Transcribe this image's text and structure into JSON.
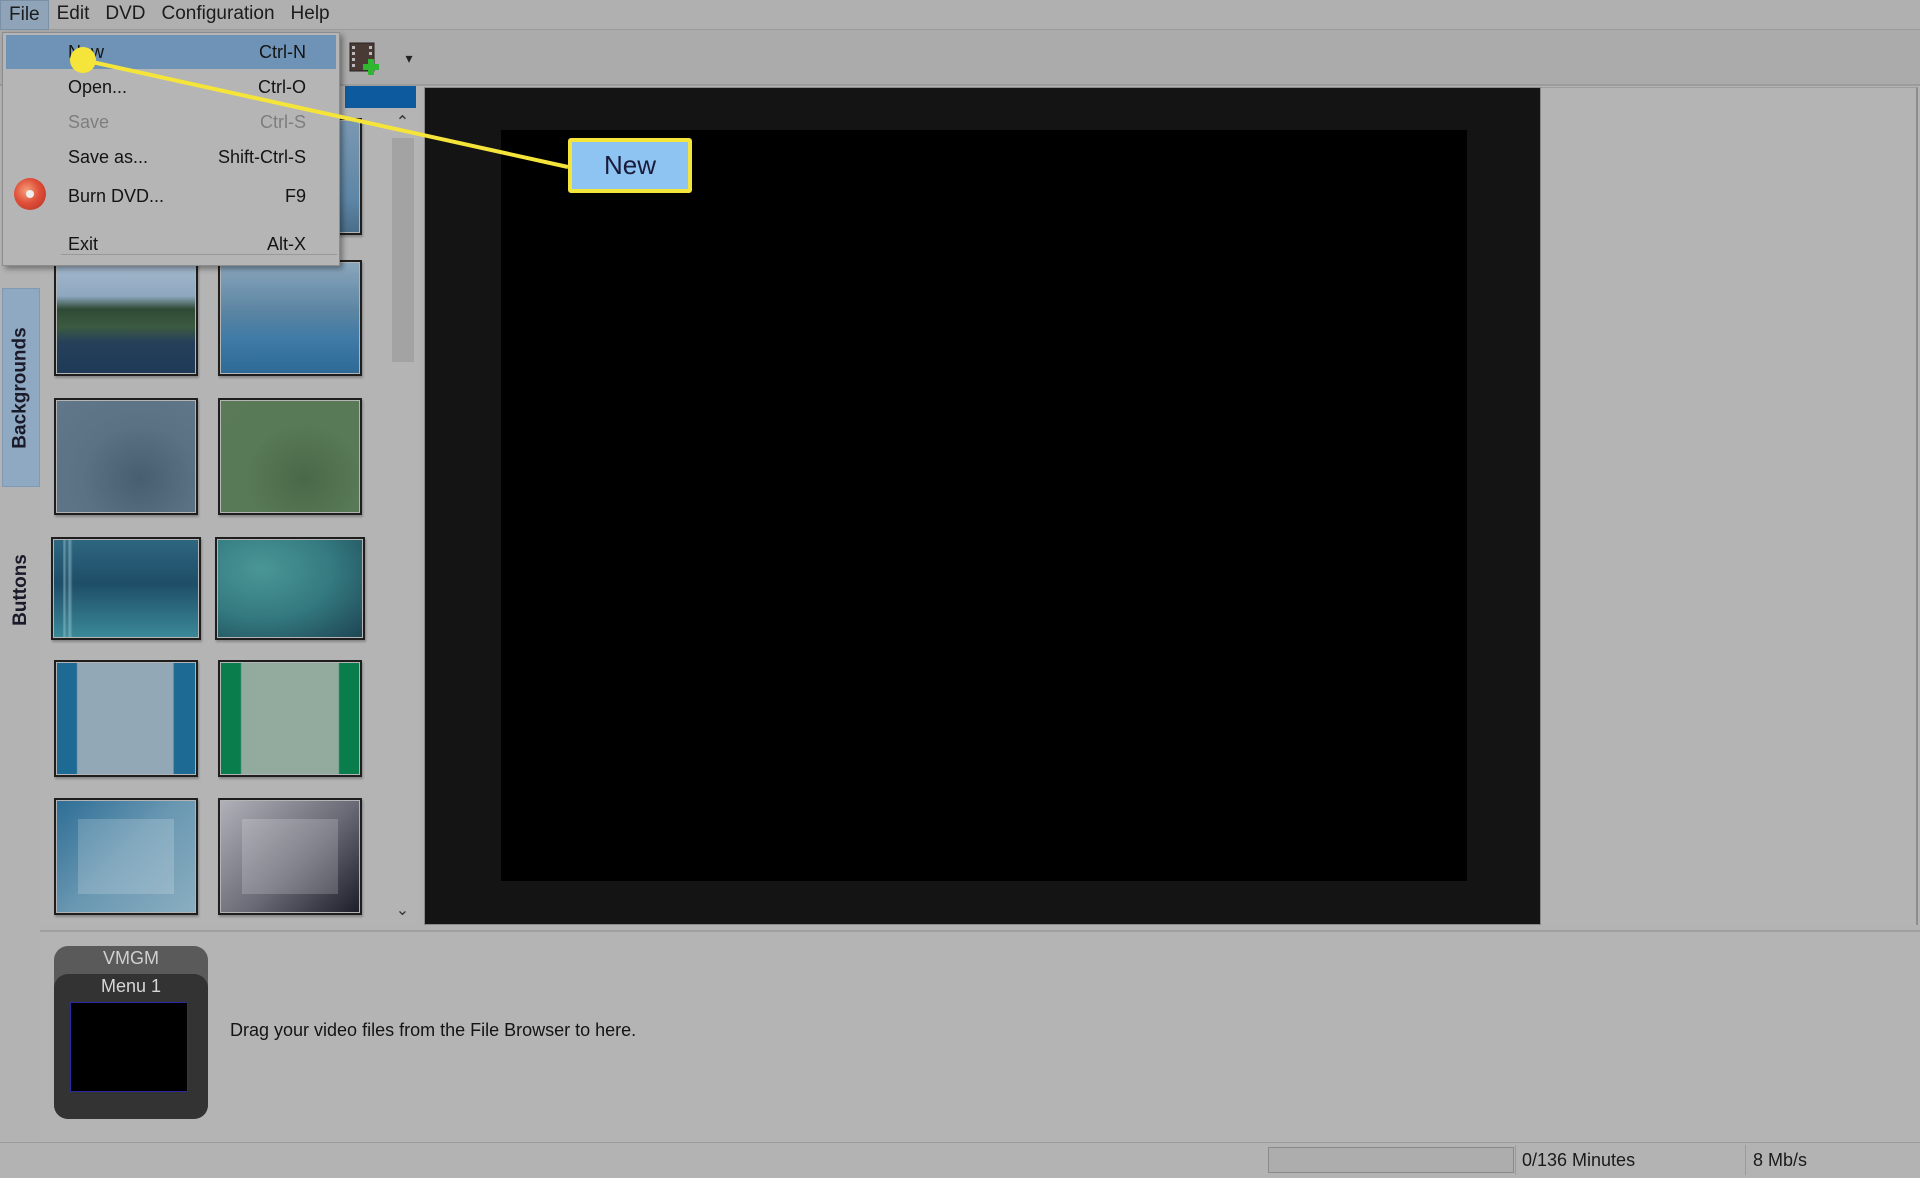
{
  "menubar": {
    "items": [
      {
        "label": "File",
        "active": true
      },
      {
        "label": "Edit"
      },
      {
        "label": "DVD"
      },
      {
        "label": "Configuration"
      },
      {
        "label": "Help"
      }
    ]
  },
  "file_menu": {
    "items": [
      {
        "label": "New",
        "shortcut": "Ctrl-N",
        "highlighted": true,
        "enabled": true
      },
      {
        "label": "Open...",
        "shortcut": "Ctrl-O",
        "enabled": true
      },
      {
        "label": "Save",
        "shortcut": "Ctrl-S",
        "enabled": false
      },
      {
        "label": "Save as...",
        "shortcut": "Shift-Ctrl-S",
        "enabled": true
      },
      {
        "label": "Burn DVD...",
        "shortcut": "F9",
        "enabled": true,
        "icon": "burn-dvd-icon"
      },
      {
        "label": "Exit",
        "shortcut": "Alt-X",
        "enabled": true
      }
    ]
  },
  "toolbar": {
    "add_video_icon": "film-add-icon",
    "dropdown_glyph": "▾"
  },
  "side_tabs": {
    "backgrounds": "Backgrounds",
    "buttons": "Buttons",
    "active": "Backgrounds"
  },
  "thumbnails": {
    "scroll_up_glyph": "⌃",
    "scroll_down_glyph": "⌄",
    "items": [
      {
        "name": "sky-partial",
        "colors": [
          "#6f8eaa",
          "#9ab0c2"
        ]
      },
      {
        "name": "sky-partial-2",
        "colors": [
          "#5f86a6",
          "#8aa8c0"
        ]
      },
      {
        "name": "lake-shore",
        "colors": [
          "#8fa8c0",
          "#2e4a38"
        ]
      },
      {
        "name": "blue-hills",
        "colors": [
          "#7f9db4",
          "#3b78a4"
        ]
      },
      {
        "name": "blue-grey-cloud",
        "colors": [
          "#607a8e",
          "#4d6577"
        ]
      },
      {
        "name": "green-cloud",
        "colors": [
          "#5c7a5a",
          "#4c6a4a"
        ]
      },
      {
        "name": "teal-stripes",
        "colors": [
          "#2c5f78",
          "#3a8a98"
        ]
      },
      {
        "name": "teal-texture",
        "colors": [
          "#3e8088",
          "#24505a"
        ]
      },
      {
        "name": "blue-side-bars",
        "colors": [
          "#1d6a94",
          "#92a8b6"
        ]
      },
      {
        "name": "green-side-bars",
        "colors": [
          "#0a7d4d",
          "#93aa9e"
        ]
      },
      {
        "name": "blue-frame",
        "colors": [
          "#2e6e96",
          "#7ea4b8"
        ]
      },
      {
        "name": "grey-frame",
        "colors": [
          "#9a9aa2",
          "#1e1e2a"
        ]
      }
    ]
  },
  "titleset": {
    "vmgm_label": "VMGM",
    "menu_label": "Menu 1",
    "drag_hint": "Drag your video files from the File Browser to here."
  },
  "statusbar": {
    "progress": 0,
    "minutes": "0/136 Minutes",
    "bitrate": "8 Mb/s"
  },
  "annotation": {
    "label": "New",
    "colors": {
      "line": "#f5e43a",
      "fill": "#8ec4f2"
    }
  }
}
